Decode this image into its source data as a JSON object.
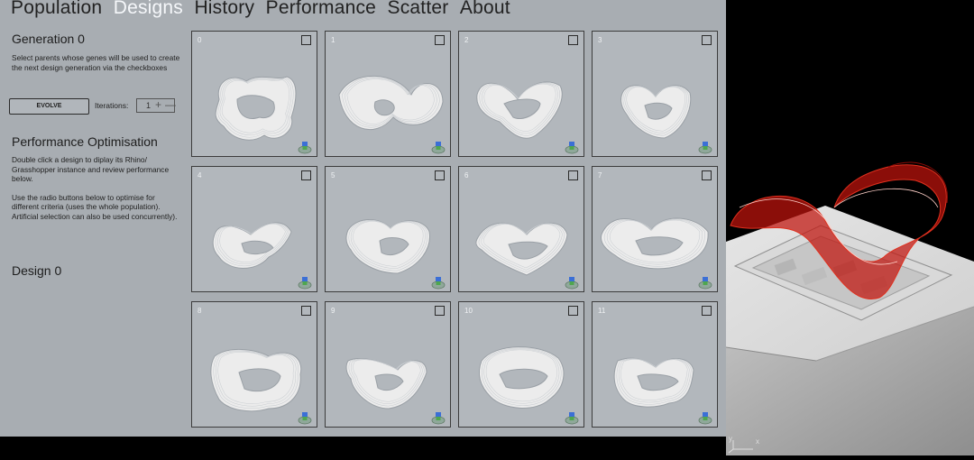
{
  "tabs": [
    {
      "label": "Population",
      "active": false
    },
    {
      "label": "Designs",
      "active": true
    },
    {
      "label": "History",
      "active": false
    },
    {
      "label": "Performance",
      "active": false
    },
    {
      "label": "Scatter",
      "active": false
    },
    {
      "label": "About",
      "active": false
    }
  ],
  "generation": {
    "title": "Generation 0",
    "description": "Select parents whose genes will be used to create the next design generation via the checkboxes"
  },
  "evolve": {
    "button_label": "EVOLVE",
    "iterations_label": "Iterations:",
    "iterations_value": "1",
    "plus_glyph": "+",
    "minus_glyph": "—"
  },
  "performance": {
    "title": "Performance Optimisation",
    "description1": "Double click a design to diplay its Rhino/ Grasshopper instance and review performance below.",
    "description2": "Use the radio buttons below to optimise for different criteria (uses the whole population). Artificial selection can also be used concurrently)."
  },
  "design_title": "Design 0",
  "designs": [
    {
      "number": "0",
      "selected": false
    },
    {
      "number": "1",
      "selected": false
    },
    {
      "number": "2",
      "selected": false
    },
    {
      "number": "3",
      "selected": false
    },
    {
      "number": "4",
      "selected": false
    },
    {
      "number": "5",
      "selected": false
    },
    {
      "number": "6",
      "selected": false
    },
    {
      "number": "7",
      "selected": false
    },
    {
      "number": "8",
      "selected": false
    },
    {
      "number": "9",
      "selected": false
    },
    {
      "number": "10",
      "selected": false
    },
    {
      "number": "11",
      "selected": false
    }
  ],
  "viewport": {
    "axis_x": "x",
    "axis_y": "y",
    "highlight_color": "#c0140c"
  },
  "colors": {
    "panel_bg": "#a8adb2",
    "active_tab": "#f5f7fa",
    "cell_bg": "#b2b7bc"
  }
}
